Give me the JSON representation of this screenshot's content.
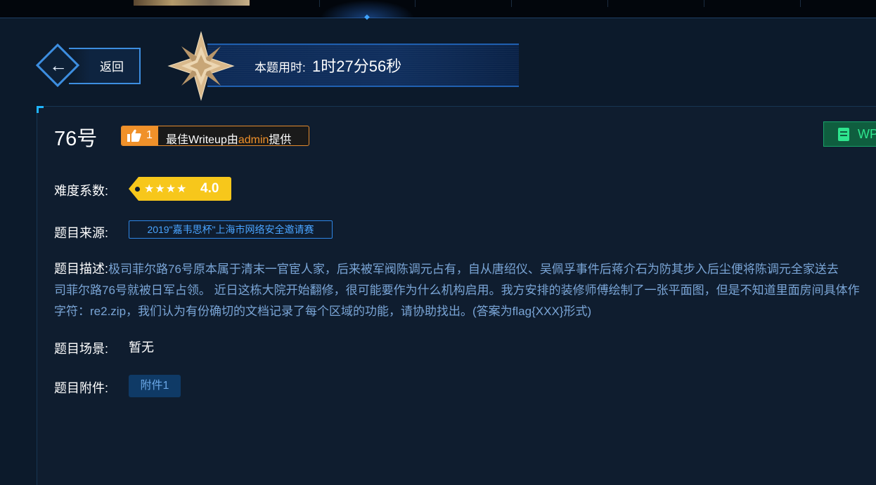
{
  "back": {
    "label": "返回"
  },
  "timer": {
    "label": "本题用时:",
    "value": "1时27分56秒"
  },
  "challenge": {
    "title": "76号"
  },
  "writeup": {
    "likes": "1",
    "prefix": "最佳Writeup由",
    "author": "admin",
    "suffix": "提供",
    "wp_button_label": "WP"
  },
  "fields": {
    "difficulty_label": "难度系数:",
    "difficulty_score": "4.0",
    "difficulty_stars": "★★★★",
    "source_label": "题目来源:",
    "source_value": "2019\"嘉韦思杯\"上海市网络安全邀请赛",
    "desc_label": "题目描述:",
    "desc_line1": "极司菲尔路76号原本属于清末一官宦人家，后来被军阀陈调元占有，自从唐绍仪、吴佩孚事件后蒋介石为防其步入后尘便将陈调元全家送去",
    "desc_line2": "司菲尔路76号就被日军占领。 近日这栋大院开始翻修，很可能要作为什么机构启用。我方安排的装修师傅绘制了一张平面图，但是不知道里面房间具体作",
    "desc_line3": "字符：re2.zip，我们认为有份确切的文档记录了每个区域的功能，请协助找出。(答案为flag{XXX}形式)",
    "scene_label": "题目场景:",
    "scene_value": "暂无",
    "attachment_label": "题目附件:",
    "attachment_button": "附件1"
  },
  "colors": {
    "background": "#0c1a2b",
    "panel": "#0f1d2f",
    "accent_blue": "#2e87e6",
    "accent_orange": "#f0912a",
    "difficulty_yellow": "#f7c71b",
    "wp_green": "#2ee58e"
  },
  "icons": {
    "back": "arrow-left-icon",
    "award": "gold-star-icon",
    "like": "thumbs-up-icon",
    "wp": "document-icon"
  }
}
